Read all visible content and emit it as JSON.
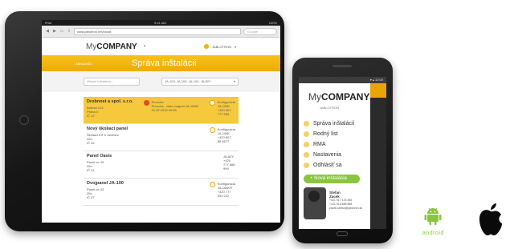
{
  "tablet": {
    "browser": {
      "url": "www.jablotron.net/cloud",
      "search_placeholder": "Google"
    },
    "app": {
      "logo_my": "My",
      "logo_company": "COMPANY",
      "user_name": "JABLOTRON"
    },
    "band": {
      "back_label": "ZÁKAZNÍCI",
      "title": "Správa inštalácií"
    },
    "filters": {
      "search_placeholder": "Hľadať inštaláciu...",
      "select_value": "JA-103, JA-106, JA-100, JA-82Y"
    },
    "rows": [
      {
        "name": "Drobnost a spol. s.r.o.",
        "l2": "Adresa 123",
        "l3": "Praha 4",
        "l4": "IČ 12",
        "status_title": "Porucha",
        "status_text": "Porucha - čidlo magnet JA-150M",
        "status_date": "01.02.2015 09:55",
        "cfg": "Konfigurácia",
        "cfg2": "JA-106K",
        "cfg3": "+420 607 777 999",
        "highlight": true,
        "dot": "red"
      },
      {
        "name": "Nový školiaci panel",
        "l2": "Školiaci KIT k ústredni",
        "l3": "Zlín",
        "l4": "IČ 32",
        "status_title": "",
        "status_text": "",
        "status_date": "",
        "cfg": "Konfigurácia",
        "cfg2": "JA-106K",
        "cfg3": "+420 607 88 5577",
        "highlight": false,
        "dot": "ring"
      },
      {
        "name": "Panel Oasis",
        "l2": "Panel ve 43",
        "l3": "Zlín",
        "l4": "IČ 41",
        "status_title": "",
        "status_text": "",
        "status_date": "",
        "cfg": "",
        "cfg2": "JA-82Y",
        "cfg3": "+420 777 888 999",
        "highlight": false,
        "dot": "none"
      },
      {
        "name": "Dvojpanel JA-100",
        "l2": "Panel ve 43",
        "l3": "Zlín",
        "l4": "IČ 57",
        "status_title": "",
        "status_text": "",
        "status_date": "",
        "cfg": "Konfigurácia",
        "cfg2": "JA-106KR",
        "cfg3": "+420 777 333 222",
        "highlight": false,
        "dot": "ring"
      }
    ]
  },
  "phone": {
    "logo_my": "My",
    "logo_company": "COMPANY",
    "logo_sub": "JABLOTRON",
    "menu": [
      "Správa inštalácií",
      "Rodný list",
      "RMA",
      "Nastavenia",
      "Odhlásiť sa"
    ],
    "new_button": "+ Nová inštalácia",
    "contact": {
      "name_first": "Stefan",
      "name_last": "Zacek",
      "phone": "+421 917 123 456",
      "phone2": "+421 918 888 888",
      "email": "zacek.stefan@jablotron.sk"
    }
  },
  "platforms": {
    "android_label": "android"
  }
}
